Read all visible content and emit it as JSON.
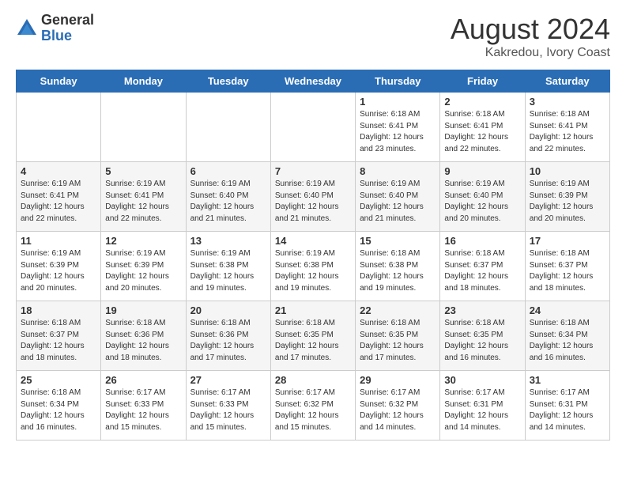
{
  "header": {
    "logo_general": "General",
    "logo_blue": "Blue",
    "month_title": "August 2024",
    "location": "Kakredou, Ivory Coast"
  },
  "weekdays": [
    "Sunday",
    "Monday",
    "Tuesday",
    "Wednesday",
    "Thursday",
    "Friday",
    "Saturday"
  ],
  "weeks": [
    [
      {
        "day": "",
        "info": ""
      },
      {
        "day": "",
        "info": ""
      },
      {
        "day": "",
        "info": ""
      },
      {
        "day": "",
        "info": ""
      },
      {
        "day": "1",
        "info": "Sunrise: 6:18 AM\nSunset: 6:41 PM\nDaylight: 12 hours\nand 23 minutes."
      },
      {
        "day": "2",
        "info": "Sunrise: 6:18 AM\nSunset: 6:41 PM\nDaylight: 12 hours\nand 22 minutes."
      },
      {
        "day": "3",
        "info": "Sunrise: 6:18 AM\nSunset: 6:41 PM\nDaylight: 12 hours\nand 22 minutes."
      }
    ],
    [
      {
        "day": "4",
        "info": "Sunrise: 6:19 AM\nSunset: 6:41 PM\nDaylight: 12 hours\nand 22 minutes."
      },
      {
        "day": "5",
        "info": "Sunrise: 6:19 AM\nSunset: 6:41 PM\nDaylight: 12 hours\nand 22 minutes."
      },
      {
        "day": "6",
        "info": "Sunrise: 6:19 AM\nSunset: 6:40 PM\nDaylight: 12 hours\nand 21 minutes."
      },
      {
        "day": "7",
        "info": "Sunrise: 6:19 AM\nSunset: 6:40 PM\nDaylight: 12 hours\nand 21 minutes."
      },
      {
        "day": "8",
        "info": "Sunrise: 6:19 AM\nSunset: 6:40 PM\nDaylight: 12 hours\nand 21 minutes."
      },
      {
        "day": "9",
        "info": "Sunrise: 6:19 AM\nSunset: 6:40 PM\nDaylight: 12 hours\nand 20 minutes."
      },
      {
        "day": "10",
        "info": "Sunrise: 6:19 AM\nSunset: 6:39 PM\nDaylight: 12 hours\nand 20 minutes."
      }
    ],
    [
      {
        "day": "11",
        "info": "Sunrise: 6:19 AM\nSunset: 6:39 PM\nDaylight: 12 hours\nand 20 minutes."
      },
      {
        "day": "12",
        "info": "Sunrise: 6:19 AM\nSunset: 6:39 PM\nDaylight: 12 hours\nand 20 minutes."
      },
      {
        "day": "13",
        "info": "Sunrise: 6:19 AM\nSunset: 6:38 PM\nDaylight: 12 hours\nand 19 minutes."
      },
      {
        "day": "14",
        "info": "Sunrise: 6:19 AM\nSunset: 6:38 PM\nDaylight: 12 hours\nand 19 minutes."
      },
      {
        "day": "15",
        "info": "Sunrise: 6:18 AM\nSunset: 6:38 PM\nDaylight: 12 hours\nand 19 minutes."
      },
      {
        "day": "16",
        "info": "Sunrise: 6:18 AM\nSunset: 6:37 PM\nDaylight: 12 hours\nand 18 minutes."
      },
      {
        "day": "17",
        "info": "Sunrise: 6:18 AM\nSunset: 6:37 PM\nDaylight: 12 hours\nand 18 minutes."
      }
    ],
    [
      {
        "day": "18",
        "info": "Sunrise: 6:18 AM\nSunset: 6:37 PM\nDaylight: 12 hours\nand 18 minutes."
      },
      {
        "day": "19",
        "info": "Sunrise: 6:18 AM\nSunset: 6:36 PM\nDaylight: 12 hours\nand 18 minutes."
      },
      {
        "day": "20",
        "info": "Sunrise: 6:18 AM\nSunset: 6:36 PM\nDaylight: 12 hours\nand 17 minutes."
      },
      {
        "day": "21",
        "info": "Sunrise: 6:18 AM\nSunset: 6:35 PM\nDaylight: 12 hours\nand 17 minutes."
      },
      {
        "day": "22",
        "info": "Sunrise: 6:18 AM\nSunset: 6:35 PM\nDaylight: 12 hours\nand 17 minutes."
      },
      {
        "day": "23",
        "info": "Sunrise: 6:18 AM\nSunset: 6:35 PM\nDaylight: 12 hours\nand 16 minutes."
      },
      {
        "day": "24",
        "info": "Sunrise: 6:18 AM\nSunset: 6:34 PM\nDaylight: 12 hours\nand 16 minutes."
      }
    ],
    [
      {
        "day": "25",
        "info": "Sunrise: 6:18 AM\nSunset: 6:34 PM\nDaylight: 12 hours\nand 16 minutes."
      },
      {
        "day": "26",
        "info": "Sunrise: 6:17 AM\nSunset: 6:33 PM\nDaylight: 12 hours\nand 15 minutes."
      },
      {
        "day": "27",
        "info": "Sunrise: 6:17 AM\nSunset: 6:33 PM\nDaylight: 12 hours\nand 15 minutes."
      },
      {
        "day": "28",
        "info": "Sunrise: 6:17 AM\nSunset: 6:32 PM\nDaylight: 12 hours\nand 15 minutes."
      },
      {
        "day": "29",
        "info": "Sunrise: 6:17 AM\nSunset: 6:32 PM\nDaylight: 12 hours\nand 14 minutes."
      },
      {
        "day": "30",
        "info": "Sunrise: 6:17 AM\nSunset: 6:31 PM\nDaylight: 12 hours\nand 14 minutes."
      },
      {
        "day": "31",
        "info": "Sunrise: 6:17 AM\nSunset: 6:31 PM\nDaylight: 12 hours\nand 14 minutes."
      }
    ]
  ]
}
